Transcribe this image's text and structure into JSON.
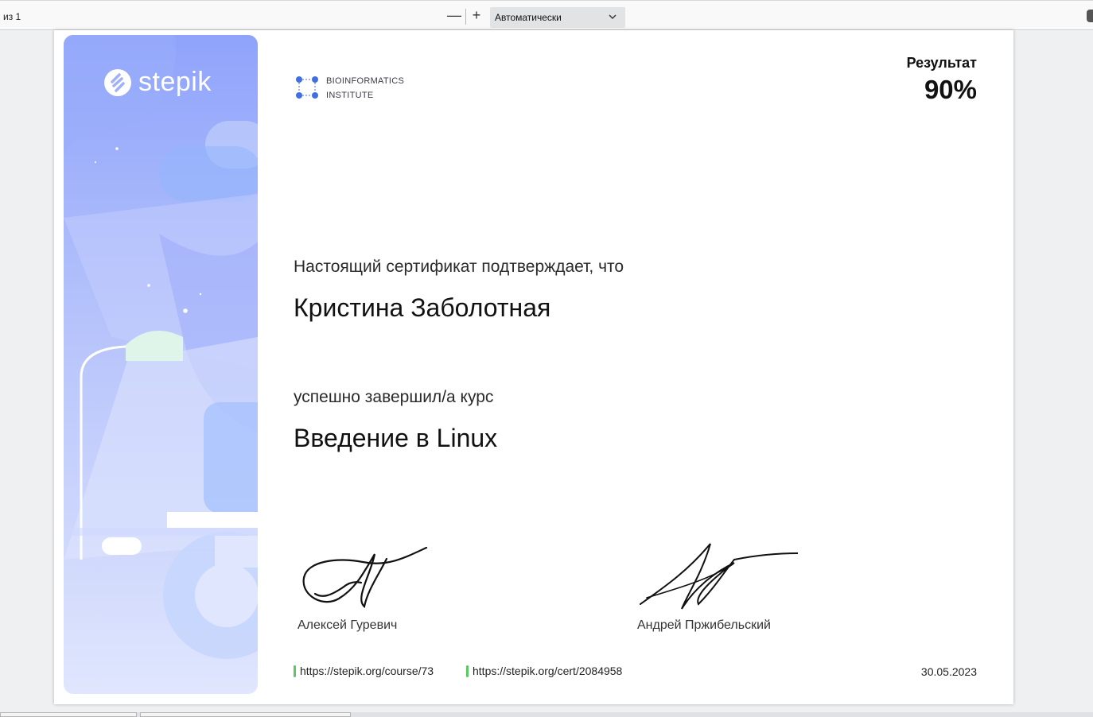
{
  "toolbar": {
    "page_of": "из 1",
    "zoom_out_symbol": "—",
    "zoom_in_symbol": "+",
    "zoom_value": "Автоматически",
    "icons": [
      "zoom-out-icon",
      "zoom-in-icon",
      "chevron-down-icon"
    ]
  },
  "certificate": {
    "brand": "stepik",
    "partner_line1": "BIOINFORMATICS",
    "partner_line2": "INSTITUTE",
    "result_label": "Результат",
    "result_value": "90%",
    "confirm_text": "Настоящий сертификат подтверждает, что",
    "recipient_name": "Кристина Заболотная",
    "completed_text": "успешно завершил/а  курс",
    "course_title": "Введение в Linux",
    "signers": [
      "Алексей Гуревич",
      "Андрей Пржибельский"
    ],
    "course_link": "https://stepik.org/course/73",
    "cert_link": "https://stepik.org/cert/2084958",
    "date": "30.05.2023",
    "colors": {
      "panel_top": "#8ea2fb",
      "panel_bottom": "#dfe5fc",
      "link_marker": "#59c964",
      "partner_dots": "#3f6fe0"
    }
  }
}
